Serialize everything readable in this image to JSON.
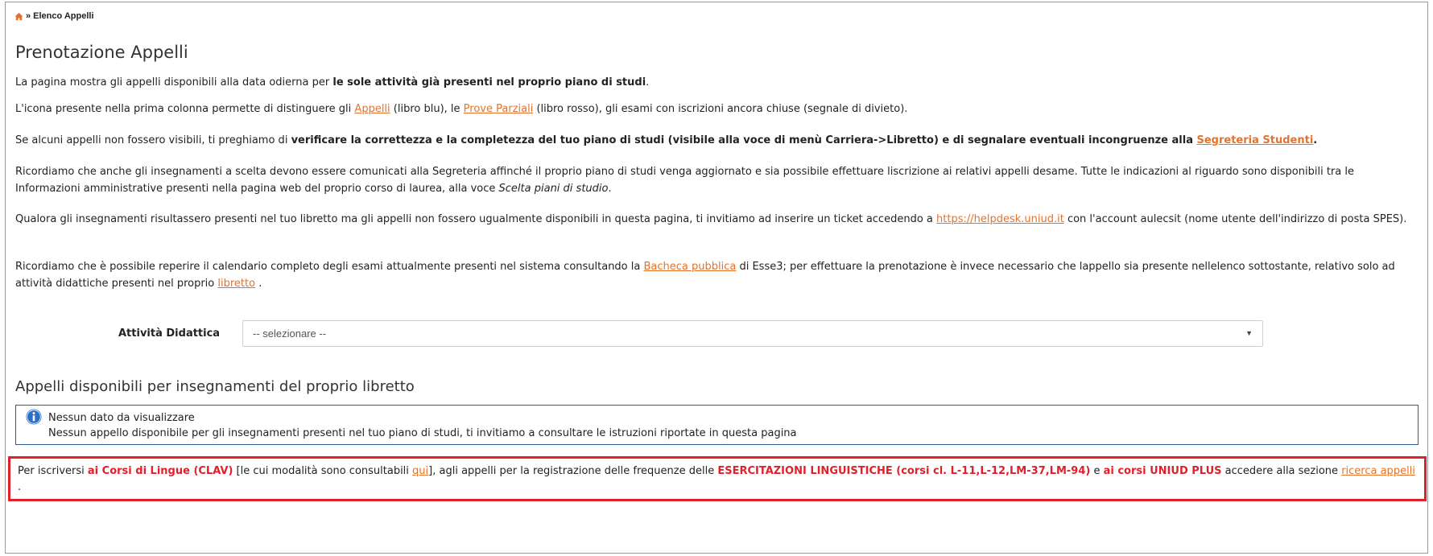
{
  "breadcrumb": {
    "current": "Elenco Appelli",
    "separator": "»"
  },
  "title": "Prenotazione Appelli",
  "p1": {
    "text": "La pagina mostra gli appelli disponibili alla data odierna per ",
    "bold": "le sole attività già presenti nel proprio piano di studi",
    "end": "."
  },
  "p2": {
    "t1": "L'icona presente nella prima colonna permette di distinguere gli ",
    "l1": "Appelli",
    "t2": " (libro blu), le ",
    "l2": "Prove Parziali",
    "t3": " (libro rosso), gli esami con iscrizioni ancora chiuse (segnale di divieto)."
  },
  "p3": {
    "t1": "Se alcuni appelli non fossero visibili, ti preghiamo di ",
    "bold": "verificare la correttezza e la completezza del tuo piano di studi (visibile alla voce di menù Carriera->Libretto) e di segnalare eventuali incongruenze alla ",
    "link": "Segreteria Studenti",
    "end": "."
  },
  "p4": {
    "t1": "Ricordiamo che anche gli insegnamenti a scelta devono essere comunicati alla Segreteria affinché il proprio piano di studi venga aggiornato e sia possibile effettuare liscrizione ai relativi appelli desame. Tutte le indicazioni al riguardo sono disponibili tra le Informazioni amministrative presenti nella pagina web del proprio corso di laurea, alla voce ",
    "italic": "Scelta piani di studio",
    "end": "."
  },
  "p5": {
    "t1": "Qualora gli insegnamenti risultassero presenti nel tuo libretto ma gli appelli non fossero ugualmente disponibili in questa pagina, ti invitiamo ad inserire un ticket accedendo a ",
    "link": "https://helpdesk.uniud.it",
    "t2": " con l'account aulecsit (nome utente dell'indirizzo di posta SPES)."
  },
  "p6": {
    "t1": "Ricordiamo che è possibile reperire il calendario completo degli esami attualmente presenti nel sistema consultando la ",
    "l1": "Bacheca pubblica",
    "t2": " di Esse3; per effettuare la prenotazione è invece necessario che lappello sia presente nellelenco sottostante, relativo solo ad attività didattiche presenti nel proprio ",
    "l2": "libretto",
    "end": " ."
  },
  "form": {
    "label": "Attività Didattica",
    "selected": "-- selezionare --"
  },
  "subtitle": "Appelli disponibili per insegnamenti del proprio libretto",
  "info": {
    "line1": "Nessun dato da visualizzare",
    "line2": "Nessun appello disponibile per gli insegnamenti presenti nel tuo piano di studi, ti invitiamo a consultare le istruzioni riportate in questa pagina"
  },
  "notice": {
    "t1": "Per iscriversi ",
    "r1": "ai Corsi di Lingue (CLAV)",
    "t2": " [le cui modalità sono consultabili ",
    "l1": "qui",
    "t3": "], agli appelli per la registrazione delle frequenze delle ",
    "r2": "ESERCITAZIONI LINGUISTICHE (corsi cl. L-11,L-12,LM-37,LM-94)",
    "t4": " e ",
    "r3": "ai corsi UNIUD PLUS",
    "t5": " accedere alla sezione ",
    "l2": "ricerca appelli",
    "end": " ."
  },
  "colors": {
    "link": "#e5722b",
    "alert": "#e0202a",
    "info_border": "#2c5f8f"
  },
  "icons": {
    "home": "home-icon",
    "info": "info-icon",
    "select_caret": "chevron-down-icon"
  }
}
